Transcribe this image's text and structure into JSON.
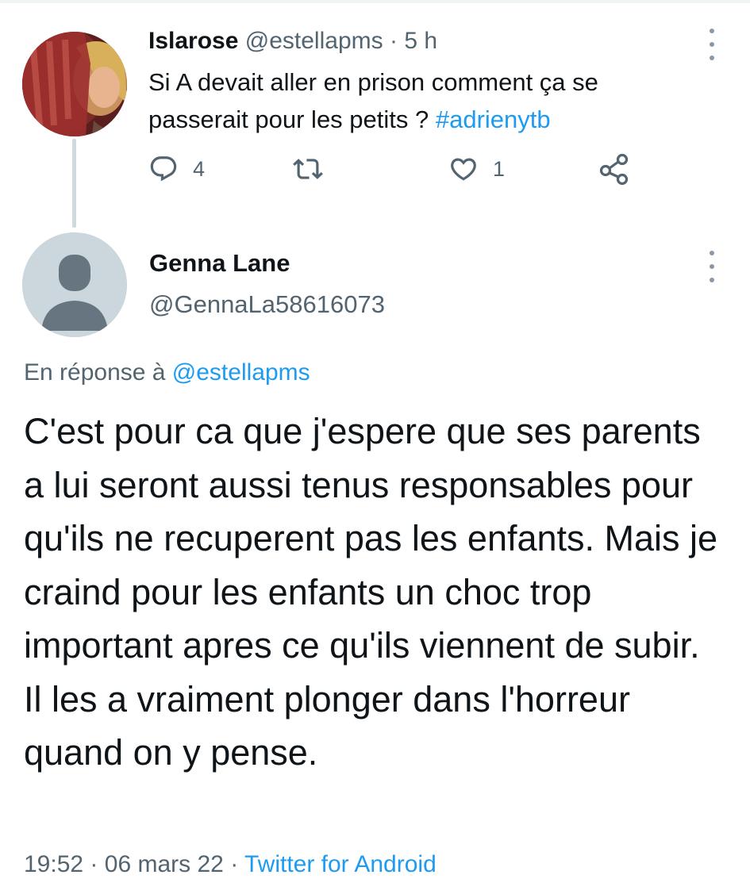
{
  "parent_tweet": {
    "display_name": "Islarose",
    "handle": "@estellapms",
    "separator": "·",
    "time": "5 h",
    "text_main": "Si A devait aller en prison comment ça se passerait pour les petits ? ",
    "hashtag": "#adrienytb",
    "actions": {
      "reply_count": "4",
      "retweet_count": "",
      "like_count": "1"
    }
  },
  "reply_tweet": {
    "display_name": "Genna Lane",
    "handle": "@GennaLa58616073",
    "reply_prefix": "En réponse à ",
    "reply_mention": "@estellapms",
    "text": "C'est pour ca que j'espere que ses parents a lui seront aussi tenus responsables pour qu'ils ne recuperent pas les enfants. Mais je craind pour les enfants un choc trop important apres ce qu'ils viennent de subir. Il les a vraiment plonger dans l'horreur quand on y pense.",
    "time": "19:52",
    "separator": "·",
    "date": "06 mars 22",
    "source": "Twitter for Android"
  },
  "icons": {
    "reply": "reply-icon",
    "retweet": "retweet-icon",
    "like": "heart-icon",
    "share": "share-icon",
    "more": "more-vertical-icon"
  },
  "colors": {
    "link": "#1d9bf0",
    "secondary_text": "#536471",
    "primary_text": "#0f1419",
    "thread_line": "#cfd9de",
    "default_avatar_bg": "#ccd6dd"
  }
}
